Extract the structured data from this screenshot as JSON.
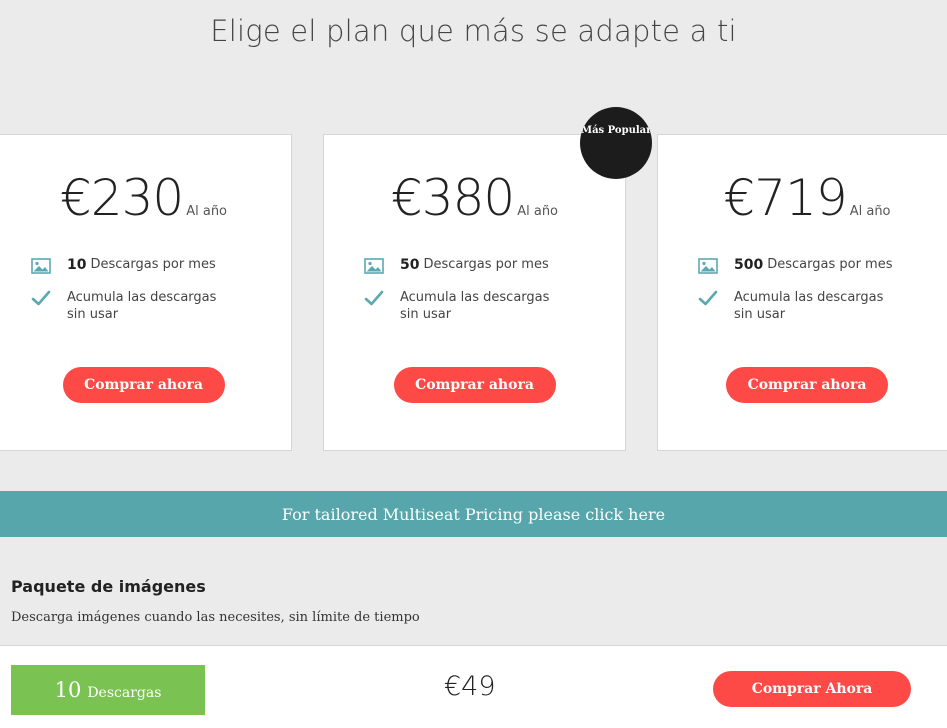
{
  "headline": "Elige el plan que más se adapte a ti",
  "badge": "Más Popular",
  "plans": [
    {
      "price": "€230",
      "period": "Al año",
      "downloads_qty": "10",
      "downloads_label": "Descargas por mes",
      "feature2": "Acumula las descargas sin usar",
      "button": "Comprar ahora"
    },
    {
      "price": "€380",
      "period": "Al año",
      "downloads_qty": "50",
      "downloads_label": "Descargas por mes",
      "feature2": "Acumula las descargas sin usar",
      "button": "Comprar ahora"
    },
    {
      "price": "€719",
      "period": "Al año",
      "downloads_qty": "500",
      "downloads_label": "Descargas por mes",
      "feature2": "Acumula las descargas sin usar",
      "button": "Comprar ahora"
    }
  ],
  "banner": "For tailored Multiseat Pricing please click here",
  "pack": {
    "title": "Paquete de imágenes",
    "description": "Descarga imágenes cuando las necesites, sin límite de tiempo",
    "downloads_qty": "10",
    "downloads_label": "Descargas",
    "price": "€49",
    "button": "Comprar Ahora"
  },
  "colors": {
    "accent_red": "#fd4a47",
    "teal": "#56a6ac",
    "green": "#7ac252",
    "badge": "#1c1c1c"
  },
  "icons": {
    "downloads": "image-icon",
    "feature": "check-icon"
  }
}
